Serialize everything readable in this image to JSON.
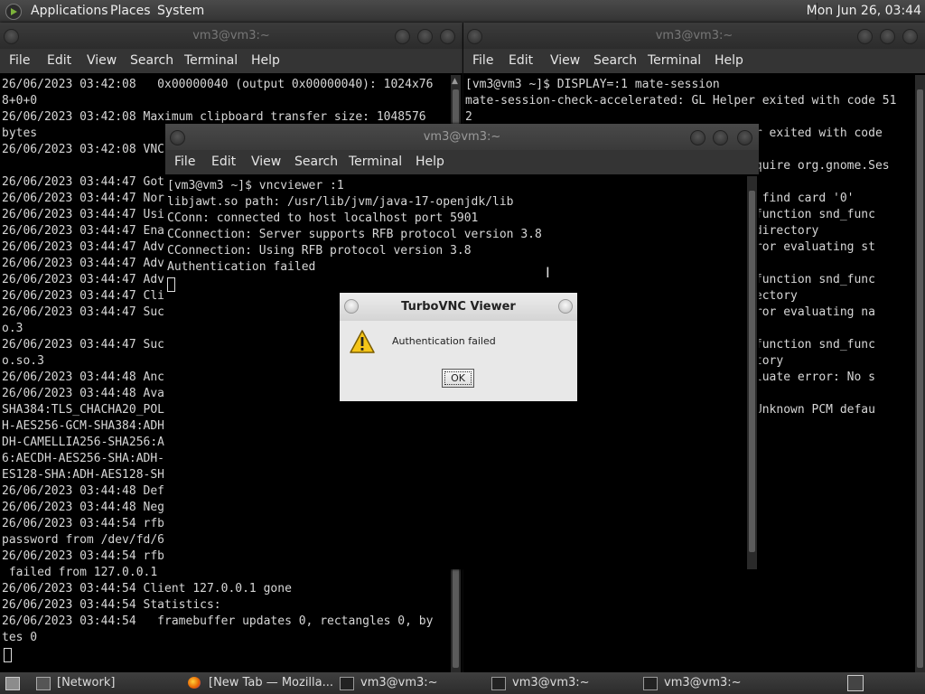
{
  "top_panel": {
    "menus": [
      "Applications",
      "Places",
      "System"
    ],
    "clock": "Mon Jun 26, 03:44"
  },
  "left_terminal": {
    "title": "vm3@vm3:~",
    "menu": [
      "File",
      "Edit",
      "View",
      "Search",
      "Terminal",
      "Help"
    ],
    "lines": [
      "26/06/2023 03:42:08   0x00000040 (output 0x00000040): 1024x76",
      "8+0+0",
      "26/06/2023 03:42:08 Maximum clipboard transfer size: 1048576",
      "bytes",
      "26/06/2023 03:42:08 VNC",
      "",
      "26/06/2023 03:44:47 Got",
      "26/06/2023 03:44:47 Nor",
      "26/06/2023 03:44:47 Usi",
      "26/06/2023 03:44:47 Ena",
      "26/06/2023 03:44:47 Adv",
      "26/06/2023 03:44:47 Adv",
      "26/06/2023 03:44:47 Adv",
      "26/06/2023 03:44:47 Cli",
      "26/06/2023 03:44:47 Suc",
      "o.3",
      "26/06/2023 03:44:47 Suc",
      "o.so.3",
      "26/06/2023 03:44:48 Anc",
      "26/06/2023 03:44:48 Ava",
      "SHA384:TLS_CHACHA20_POL",
      "H-AES256-GCM-SHA384:ADH",
      "DH-CAMELLIA256-SHA256:A",
      "6:AECDH-AES256-SHA:ADH-",
      "ES128-SHA:ADH-AES128-SH",
      "26/06/2023 03:44:48 Def",
      "26/06/2023 03:44:48 Neg",
      "26/06/2023 03:44:54 rfb",
      "password from /dev/fd/6",
      "26/06/2023 03:44:54 rfb",
      " failed from 127.0.0.1",
      "26/06/2023 03:44:54 Client 127.0.0.1 gone",
      "26/06/2023 03:44:54 Statistics:",
      "26/06/2023 03:44:54   framebuffer updates 0, rectangles 0, by",
      "tes 0"
    ]
  },
  "right_terminal": {
    "title": "vm3@vm3:~",
    "menu": [
      "File",
      "Edit",
      "View",
      "Search",
      "Terminal",
      "Help"
    ],
    "lines": [
      "[vm3@vm3 ~]$ DISPLAY=:1 mate-session",
      "mate-session-check-accelerated: GL Helper exited with code 51",
      "2",
      "                                       per exited with code",
      "",
      "                                       acquire org.gnome.Ses",
      "",
      "                                       ot find card '0'",
      "                                      e) function snd_func",
      "                                      or directory",
      "                                       error evaluating st",
      "",
      "                                      e) function snd_func",
      "                                      directory",
      "                                       error evaluating na",
      "",
      "                                      e) function snd_func",
      "                                      rectory",
      "                                      Evaluate error: No s",
      "",
      "                                      e) Unknown PCM defau"
    ]
  },
  "center_terminal": {
    "title": "vm3@vm3:~",
    "menu": [
      "File",
      "Edit",
      "View",
      "Search",
      "Terminal",
      "Help"
    ],
    "lines": [
      "[vm3@vm3 ~]$ vncviewer :1",
      "libjawt.so path: /usr/lib/jvm/java-17-openjdk/lib",
      "CConn: connected to host localhost port 5901",
      "CConnection: Server supports RFB protocol version 3.8",
      "CConnection: Using RFB protocol version 3.8",
      "Authentication failed"
    ]
  },
  "dialog": {
    "title": "TurboVNC Viewer",
    "message": "Authentication failed",
    "ok_label": "OK"
  },
  "taskbar": {
    "items": [
      "[Network]",
      "[New Tab — Mozilla...",
      "vm3@vm3:~",
      "vm3@vm3:~",
      "vm3@vm3:~"
    ]
  }
}
